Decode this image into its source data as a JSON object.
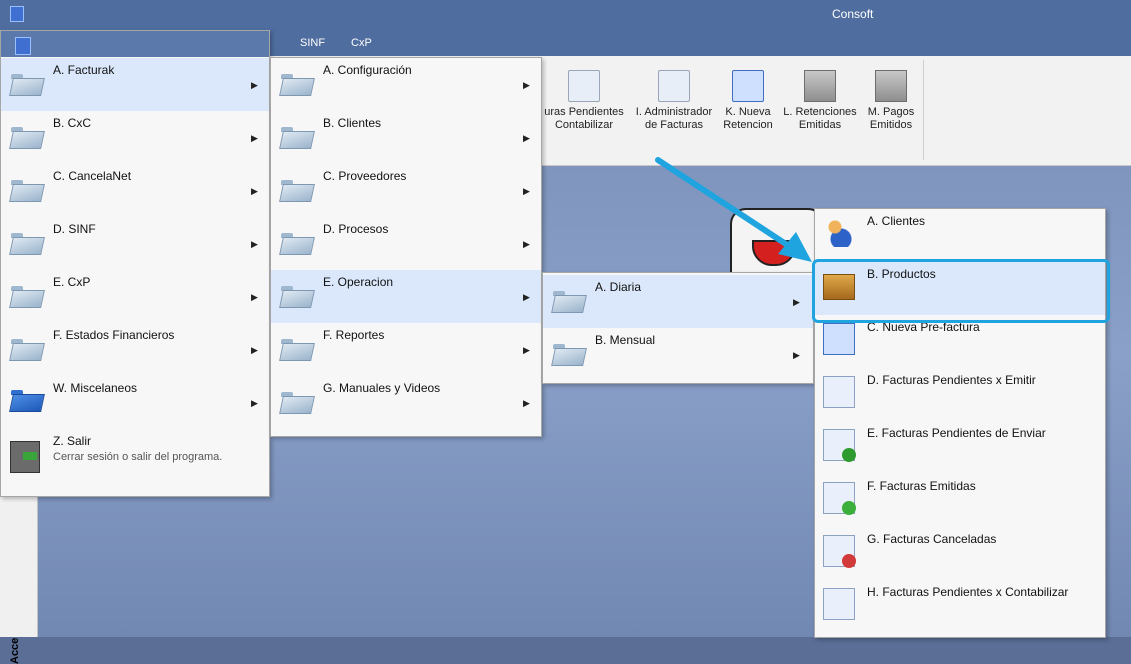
{
  "window": {
    "title": "Consoft"
  },
  "ribbon_tabs": [
    "SINF",
    "CxP"
  ],
  "ribbon_buttons": [
    {
      "label": "uras Pendientes\nContabilizar",
      "icon": "clock-document-icon"
    },
    {
      "label": "I. Administrador\nde Facturas",
      "icon": "document-icon"
    },
    {
      "label": "K. Nueva\nRetencion",
      "icon": "new-document-icon"
    },
    {
      "label": "L. Retenciones\nEmitidas",
      "icon": "stamp-icon"
    },
    {
      "label": "M. Pagos\nEmitidos",
      "icon": "stamp-icon"
    }
  ],
  "side_strip": {
    "label": "Acce"
  },
  "menu1": {
    "items": [
      {
        "label": "A. Facturak",
        "icon": "folder-icon",
        "selected": true
      },
      {
        "label": "B. CxC",
        "icon": "folder-icon"
      },
      {
        "label": "C. CancelaNet",
        "icon": "folder-icon"
      },
      {
        "label": "D. SINF",
        "icon": "folder-icon"
      },
      {
        "label": "E. CxP",
        "icon": "folder-icon"
      },
      {
        "label": "F. Estados Financieros",
        "icon": "folder-icon"
      },
      {
        "label": "W. Miscelaneos",
        "icon": "blue-folder-icon"
      },
      {
        "label": "Z. Salir",
        "sub": "Cerrar sesión o salir del programa.",
        "icon": "exit-icon"
      }
    ]
  },
  "menu2": {
    "items": [
      {
        "label": "A. Configuración"
      },
      {
        "label": "B. Clientes"
      },
      {
        "label": "C. Proveedores"
      },
      {
        "label": "D. Procesos"
      },
      {
        "label": "E. Operacion",
        "selected": true
      },
      {
        "label": "F. Reportes"
      },
      {
        "label": "G. Manuales y Videos"
      }
    ]
  },
  "menu3": {
    "items": [
      {
        "label": "A. Diaria",
        "selected": true
      },
      {
        "label": "B. Mensual"
      }
    ]
  },
  "menu4": {
    "items": [
      {
        "label": "A. Clientes",
        "icon": "clients-icon"
      },
      {
        "label": "B. Productos",
        "icon": "box-icon",
        "highlighted": true
      },
      {
        "label": "C. Nueva Pre-factura",
        "icon": "new-document-icon"
      },
      {
        "label": "D. Facturas Pendientes x Emitir",
        "icon": "clock-document-icon"
      },
      {
        "label": "E. Facturas Pendientes de Enviar",
        "icon": "send-document-icon"
      },
      {
        "label": "F. Facturas Emitidas",
        "icon": "check-document-icon"
      },
      {
        "label": "G. Facturas Canceladas",
        "icon": "cancel-document-icon"
      },
      {
        "label": "H. Facturas Pendientes x Contabilizar",
        "icon": "clock-document-icon"
      }
    ]
  },
  "colors": {
    "highlight": "#1fa4df",
    "titlebar": "#4f6d9f",
    "selection": "#dbe8fb"
  }
}
